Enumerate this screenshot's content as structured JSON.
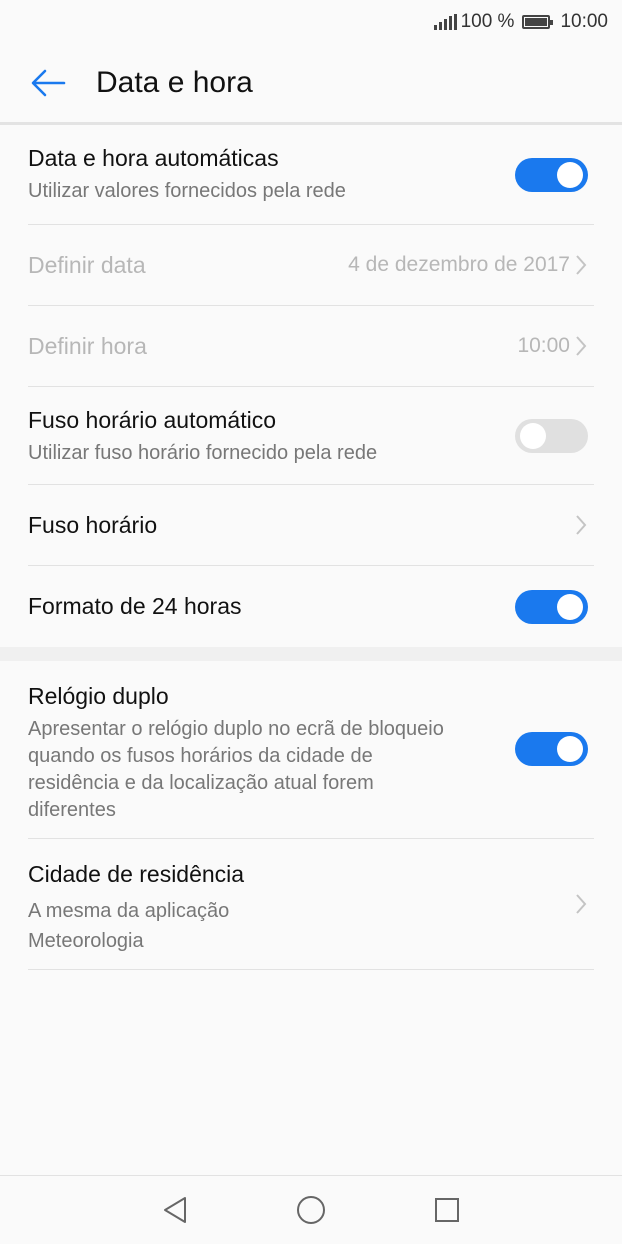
{
  "status_bar": {
    "battery_text": "100 %",
    "time": "10:00"
  },
  "app_bar": {
    "title": "Data e hora"
  },
  "settings": {
    "auto_datetime": {
      "title": "Data e hora automáticas",
      "subtitle": "Utilizar valores fornecidos pela rede",
      "enabled": true
    },
    "set_date": {
      "title": "Definir data",
      "value": "4 de dezembro de 2017"
    },
    "set_time": {
      "title": "Definir hora",
      "value": "10:00"
    },
    "auto_timezone": {
      "title": "Fuso horário automático",
      "subtitle": "Utilizar fuso horário fornecido pela rede",
      "enabled": false
    },
    "timezone": {
      "title": "Fuso horário"
    },
    "format_24h": {
      "title": "Formato de 24 horas",
      "enabled": true
    },
    "dual_clock": {
      "title": "Relógio duplo",
      "subtitle": "Apresentar o relógio duplo no ecrã de bloqueio quando os fusos horários da cidade de residência e da localização atual forem diferentes",
      "enabled": true
    },
    "home_city": {
      "title": "Cidade de residência",
      "subtitle_line1": "A mesma da aplicação",
      "subtitle_line2": "Meteorologia"
    }
  },
  "colors": {
    "accent": "#1a79ee",
    "toggle_off": "#e0e0e0",
    "disabled_text": "#b7b7b7"
  },
  "icons": {
    "back": "arrow-left-icon",
    "chevron": "chevron-right-icon",
    "nav_back": "triangle-back-icon",
    "nav_home": "circle-home-icon",
    "nav_recent": "square-recents-icon"
  }
}
